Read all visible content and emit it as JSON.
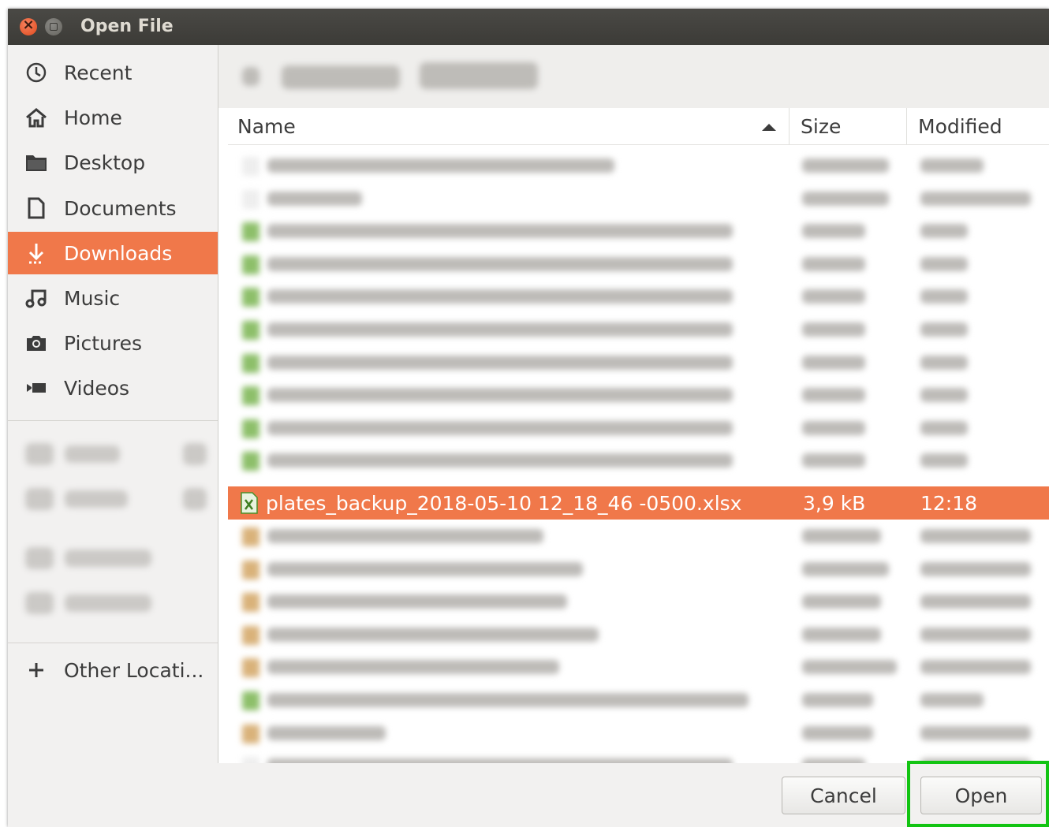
{
  "window": {
    "title": "Open File"
  },
  "sidebar": {
    "items": [
      {
        "label": "Recent",
        "icon": "clock-icon"
      },
      {
        "label": "Home",
        "icon": "home-icon"
      },
      {
        "label": "Desktop",
        "icon": "folder-icon"
      },
      {
        "label": "Documents",
        "icon": "document-icon"
      },
      {
        "label": "Downloads",
        "icon": "download-icon",
        "active": true
      },
      {
        "label": "Music",
        "icon": "music-icon"
      },
      {
        "label": "Pictures",
        "icon": "camera-icon"
      },
      {
        "label": "Videos",
        "icon": "video-icon"
      }
    ],
    "other_locations": "Other Locati..."
  },
  "file_list": {
    "columns": {
      "name": "Name",
      "size": "Size",
      "modified": "Modified"
    },
    "sort": "Name ascending",
    "selected": {
      "name": "plates_backup_2018-05-10 12_18_46 -0500.xlsx",
      "size": "3,9 kB",
      "modified": "12:18"
    }
  },
  "buttons": {
    "cancel": "Cancel",
    "open": "Open"
  },
  "colors": {
    "accent": "#f0784a",
    "highlight": "#12c412",
    "titlebar": "#3c3b37"
  }
}
